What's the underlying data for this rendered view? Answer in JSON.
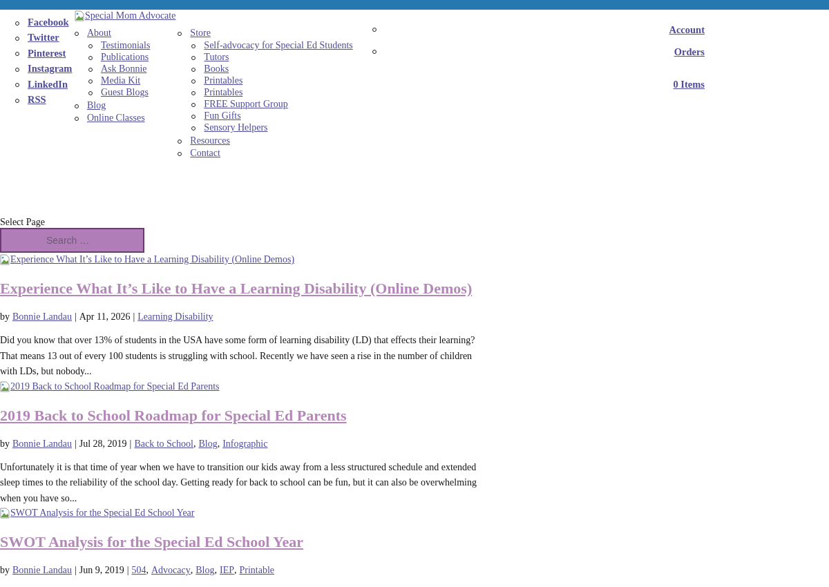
{
  "social_links": [
    "Facebook",
    "Twitter",
    "Pinterest",
    "Instagram",
    "LinkedIn",
    "RSS"
  ],
  "logo": {
    "alt": "Special Mom Advocate"
  },
  "nav": [
    {
      "label": "About",
      "children": [
        {
          "label": "Testimonials"
        },
        {
          "label": "Publications"
        },
        {
          "label": "Ask Bonnie"
        },
        {
          "label": "Media Kit"
        },
        {
          "label": "Guest Blogs"
        }
      ]
    },
    {
      "label": "Blog"
    },
    {
      "label": "Online Classes"
    },
    {
      "label": "Store",
      "children": [
        {
          "label": "Self-advocacy for Special Ed Students"
        },
        {
          "label": "Tutors"
        },
        {
          "label": "Books"
        },
        {
          "label": "Printables"
        },
        {
          "label": "Printables"
        },
        {
          "label": "FREE Support Group"
        },
        {
          "label": "Fun Gifts"
        },
        {
          "label": "Sensory Helpers"
        }
      ]
    },
    {
      "label": "Resources"
    },
    {
      "label": "Contact"
    }
  ],
  "account_links": [
    "Account",
    "Orders"
  ],
  "cart": "0 Items",
  "select_page": "Select Page",
  "search": {
    "placeholder": "Search …"
  },
  "posts": [
    {
      "image_alt": "Experience What It’s Like to Have a Learning Disability (Online Demos)",
      "title": "Experience What It’s Like to Have a Learning Disability (Online Demos)",
      "meta": [
        {
          "kind": "text",
          "text": "by"
        },
        {
          "kind": "link",
          "text": "Bonnie Landau"
        },
        {
          "kind": "text",
          "text": "|"
        },
        {
          "kind": "text",
          "text": "Apr 11, 2026"
        },
        {
          "kind": "text",
          "text": "|"
        },
        {
          "kind": "link",
          "text": "Learning Disability"
        }
      ],
      "excerpt": "Did you know that over 13% of students in the USA have some form of learning disability (LD) that effects their learning? That means 13 out of every 100 students is struggling with school. Recently we have seen a rise in the number of children with LDs, but nobody..."
    },
    {
      "image_alt": "2019 Back to School Roadmap for Special Ed Parents",
      "title": "2019 Back to School Roadmap for Special Ed Parents",
      "meta": [
        {
          "kind": "text",
          "text": "by"
        },
        {
          "kind": "link",
          "text": "Bonnie Landau"
        },
        {
          "kind": "text",
          "text": "|"
        },
        {
          "kind": "text",
          "text": "Jul 28, 2019"
        },
        {
          "kind": "text",
          "text": "|"
        },
        {
          "kind": "link",
          "text": "Back to School"
        },
        {
          "kind": "comma",
          "text": ","
        },
        {
          "kind": "link",
          "text": "Blog"
        },
        {
          "kind": "comma",
          "text": ","
        },
        {
          "kind": "link",
          "text": "Infographic"
        }
      ],
      "excerpt": "Unfortunately it is that time of year when we have to transition our kids away from a less structured schedule and extended sleep times to the reliability of the school day. Getting ready for back to school can be fun, but it can also be overwhelming when you have so..."
    },
    {
      "image_alt": "SWOT Analysis for the Special Ed School Year",
      "title": "SWOT Analysis for the Special Ed School Year",
      "meta": [
        {
          "kind": "text",
          "text": "by"
        },
        {
          "kind": "link",
          "text": "Bonnie Landau"
        },
        {
          "kind": "text",
          "text": "|"
        },
        {
          "kind": "text",
          "text": "Jun 9, 2019"
        },
        {
          "kind": "text",
          "text": "|"
        },
        {
          "kind": "link",
          "text": "504"
        },
        {
          "kind": "comma",
          "text": ","
        },
        {
          "kind": "link",
          "text": "Advocacy"
        },
        {
          "kind": "comma",
          "text": ","
        },
        {
          "kind": "link",
          "text": "Blog"
        },
        {
          "kind": "comma",
          "text": ","
        },
        {
          "kind": "link",
          "text": "IEP"
        },
        {
          "kind": "comma",
          "text": ","
        },
        {
          "kind": "link",
          "text": "Printable"
        }
      ]
    }
  ]
}
